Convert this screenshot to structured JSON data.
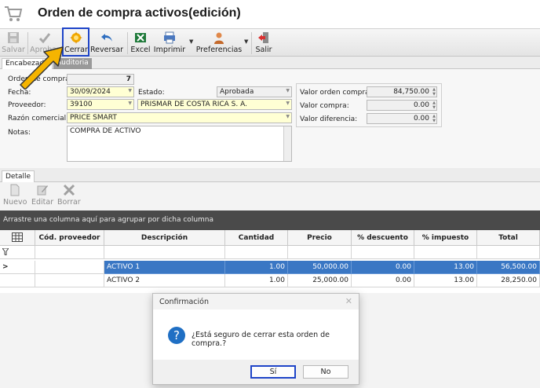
{
  "window": {
    "title": "Orden de compra activos(edición)"
  },
  "toolbar": {
    "items": [
      {
        "label": "Salvar",
        "icon": "save-icon",
        "enabled": false
      },
      {
        "label": "Aprobar",
        "icon": "check-icon",
        "enabled": false
      },
      {
        "label": "Cerrar",
        "icon": "gear-sun-icon",
        "enabled": true
      },
      {
        "label": "Reversar",
        "icon": "undo-arrow-icon",
        "enabled": true
      },
      {
        "label": "Excel",
        "icon": "excel-icon",
        "enabled": true
      },
      {
        "label": "Imprimir",
        "icon": "printer-icon",
        "enabled": true
      },
      {
        "label": "Preferencias",
        "icon": "user-prefs-icon",
        "enabled": true
      },
      {
        "label": "Salir",
        "icon": "exit-door-icon",
        "enabled": true
      }
    ]
  },
  "tabs": [
    {
      "label": "Encabezado",
      "active": true
    },
    {
      "label": "Auditoria",
      "active": false
    }
  ],
  "form": {
    "orden_label": "Orden de compra:",
    "orden_value": "7",
    "fecha_label": "Fecha:",
    "fecha_value": "30/09/2024",
    "estado_label": "Estado:",
    "estado_value": "Aprobada",
    "proveedor_label": "Proveedor:",
    "proveedor_code": "39100",
    "proveedor_name": "PRISMAR DE COSTA RICA S. A.",
    "razon_label": "Razón comercial:",
    "razon_value": "PRICE SMART",
    "notas_label": "Notas:",
    "notas_value": "COMPRA DE ACTIVO",
    "valor_orden_label": "Valor orden compra:",
    "valor_orden_value": "84,750.00",
    "valor_compra_label": "Valor compra:",
    "valor_compra_value": "0.00",
    "valor_diferencia_label": "Valor diferencia:",
    "valor_diferencia_value": "0.00"
  },
  "detalle": {
    "tab_label": "Detalle",
    "buttons": [
      {
        "label": "Nuevo",
        "icon": "new-doc-icon"
      },
      {
        "label": "Editar",
        "icon": "edit-icon"
      },
      {
        "label": "Borrar",
        "icon": "delete-x-icon"
      }
    ],
    "group_hint": "Arrastre una columna aquí para agrupar por dicha columna",
    "columns": [
      "Cód. proveedor",
      "Descripción",
      "Cantidad",
      "Precio",
      "% descuento",
      "% impuesto",
      "Total"
    ],
    "rows": [
      {
        "indicator": ">",
        "cells": [
          "",
          "ACTIVO 1",
          "1.00",
          "50,000.00",
          "0.00",
          "13.00",
          "56,500.00"
        ],
        "selected": true
      },
      {
        "indicator": "",
        "cells": [
          "",
          "ACTIVO 2",
          "1.00",
          "25,000.00",
          "0.00",
          "13.00",
          "28,250.00"
        ],
        "selected": false
      }
    ]
  },
  "dialog": {
    "title": "Confirmación",
    "message": "¿Está seguro de cerrar esta orden de compra.?",
    "yes_label": "Sí",
    "no_label": "No"
  },
  "colors": {
    "highlight_border": "#1e44c8",
    "selected_row": "#3a77c4",
    "group_bar": "#4a4a4a",
    "required_field": "#ffffd4",
    "arrow": "#f5b400"
  }
}
